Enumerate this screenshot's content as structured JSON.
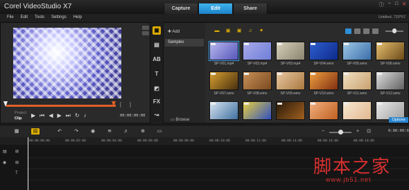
{
  "app": {
    "title": "Corel VideoStudio X7"
  },
  "tabs": [
    {
      "label": "Capture",
      "active": false
    },
    {
      "label": "Edit",
      "active": true
    },
    {
      "label": "Share",
      "active": false
    }
  ],
  "menu": [
    "File",
    "Edit",
    "Tools",
    "Settings",
    "Help"
  ],
  "project_info": "Untitled, 720*57",
  "preview": {
    "modes": [
      "Project",
      "Clip"
    ],
    "active_mode": "Clip",
    "timecode": "00:00:00:00",
    "brackets": "[ ]"
  },
  "library": {
    "add_label": "Add",
    "samples_label": "Samples",
    "browse_label": "Browse",
    "options_label": "Options",
    "thumbnails": [
      {
        "caption": "SP-V01.mp4",
        "colors": [
          "#b8b8f0",
          "#5656b8"
        ],
        "selected": true
      },
      {
        "caption": "SP-V02.mp4",
        "colors": [
          "#a9a9e8",
          "#6f7fd8"
        ]
      },
      {
        "caption": "SP-V03.mp4",
        "colors": [
          "#d6d0b8",
          "#8a8470"
        ]
      },
      {
        "caption": "SP-V04.wmv",
        "colors": [
          "#2f5fcf",
          "#0d2a8a"
        ]
      },
      {
        "caption": "SP-V05.wmv",
        "colors": [
          "#9fc8e8",
          "#3a6ea8"
        ]
      },
      {
        "caption": "SP-V06.wmv",
        "colors": [
          "#e8c070",
          "#6a4a18"
        ]
      },
      {
        "caption": "SP-V07.wmv",
        "colors": [
          "#d8a030",
          "#4a3010"
        ]
      },
      {
        "caption": "SP-V08.wmv",
        "colors": [
          "#c89058",
          "#7a4a20"
        ]
      },
      {
        "caption": "SP-V09.wmv",
        "colors": [
          "#e8c8a0",
          "#a87840"
        ]
      },
      {
        "caption": "SP-V10.wmv",
        "colors": [
          "#f0a040",
          "#803010"
        ]
      },
      {
        "caption": "SP-V11.wmv",
        "colors": [
          "#f0e0c0",
          "#c8a070"
        ]
      },
      {
        "caption": "SP-V12.wmv",
        "colors": [
          "#e0e0e0",
          "#606060"
        ]
      },
      {
        "caption": "",
        "colors": [
          "#d8e4f0",
          "#4070a0"
        ]
      },
      {
        "caption": "",
        "colors": [
          "#e8d040",
          "#3050c0"
        ]
      },
      {
        "caption": "",
        "colors": [
          "#2a1a0a",
          "#a06020"
        ]
      },
      {
        "caption": "",
        "colors": [
          "#f0b080",
          "#c06020"
        ]
      },
      {
        "caption": "",
        "colors": [
          "#f8e8d0",
          "#e0b890"
        ]
      },
      {
        "caption": "",
        "colors": [
          "#e8e8e8",
          "#a0a0a0"
        ]
      }
    ]
  },
  "timeline": {
    "timecode": "0:00:00:0",
    "ruler": [
      "00:00:00:00",
      "00:00:02:00",
      "00:00:04:00",
      "00:00:06:00",
      "00:00:08:00",
      "00:00:10:00",
      "00:00:12:00",
      "00:00:14:00",
      "00:00:16:00",
      "00:00:18:00"
    ]
  },
  "watermark": {
    "text": "脚本之家",
    "url": "www.jb51.net"
  }
}
